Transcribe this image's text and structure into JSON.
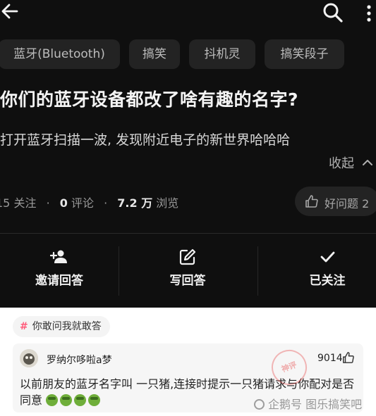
{
  "header": {
    "back_icon": "arrow-left-icon",
    "search_icon": "search-icon",
    "more_icon": "more-vertical-icon"
  },
  "tags": [
    "蓝牙(Bluetooth)",
    "搞笑",
    "抖机灵",
    "搞笑段子"
  ],
  "question": {
    "title": "你们的蓝牙设备都改了啥有趣的名字?",
    "description": "打开蓝牙扫描一波, 发现附近电子的新世界哈哈哈",
    "collapse_label": "收起"
  },
  "stats": {
    "followers_num": "15",
    "followers_label": "关注",
    "comments_num": "0",
    "comments_label": "评论",
    "views_num": "7.2 万",
    "views_label": "浏览",
    "separator": "·",
    "good_question_label": "好问题 2"
  },
  "actions": [
    {
      "label": "邀请回答",
      "icon": "add-user-icon"
    },
    {
      "label": "写回答",
      "icon": "edit-icon"
    },
    {
      "label": "已关注",
      "icon": "check-icon"
    }
  ],
  "topic": {
    "hash": "#",
    "label": "你敢问我就敢答"
  },
  "answer": {
    "username": "罗纳尔哆啦a梦",
    "likes": "9014",
    "text_line1": "以前朋友的蓝牙名字叫 一只猪,连接时提示一只猪请求与你配对是否",
    "text_line2": "同意",
    "emoji_count": 4,
    "emoji": "green-face-emoji"
  },
  "watermark": {
    "text": "企鹅号 图乐搞笑吧",
    "stamp_text": "神评"
  },
  "colors": {
    "dark_bg": "#0f0f0f",
    "chip_bg": "#232323",
    "topic_hash": "#ff5a7a",
    "card_bg": "#f6f6f6"
  }
}
